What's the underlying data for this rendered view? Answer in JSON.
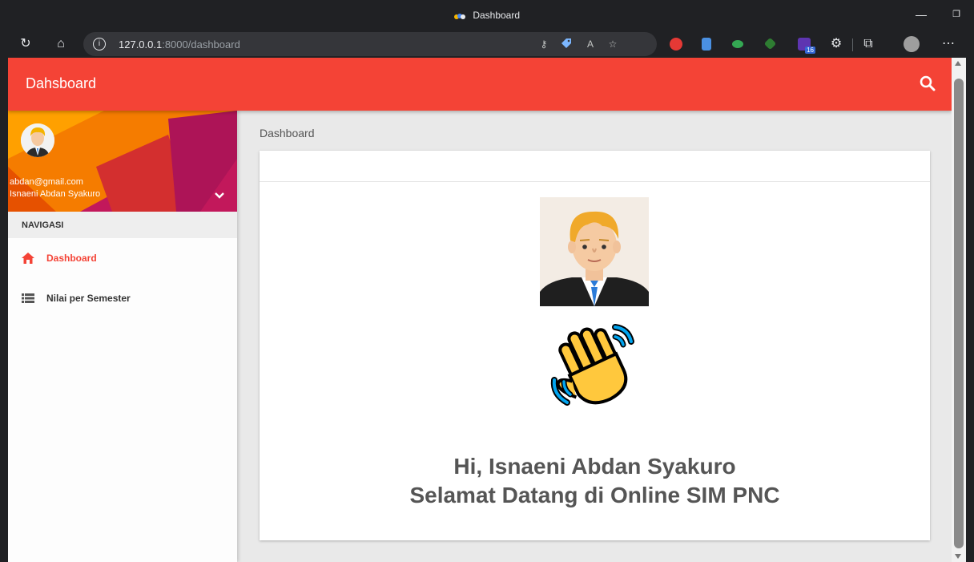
{
  "browser": {
    "window_title": "Dashboard",
    "url_host": "127.0.0.1",
    "url_path": ":8000/dashboard",
    "extension_badge": "16"
  },
  "app": {
    "brand": "Dahsboard",
    "accent_color": "#f44336",
    "breadcrumb": "Dashboard"
  },
  "user": {
    "email": "abdan@gmail.com",
    "name": "Isnaeni Abdan Syakuro"
  },
  "sidebar": {
    "section_header": "NAVIGASI",
    "items": [
      {
        "label": "Dashboard",
        "icon": "home-icon",
        "active": true
      },
      {
        "label": "Nilai per Semester",
        "icon": "list-icon",
        "active": false
      }
    ]
  },
  "main": {
    "greeting": "Hi, Isnaeni Abdan Syakuro",
    "welcome": "Selamat Datang di Online SIM PNC"
  }
}
